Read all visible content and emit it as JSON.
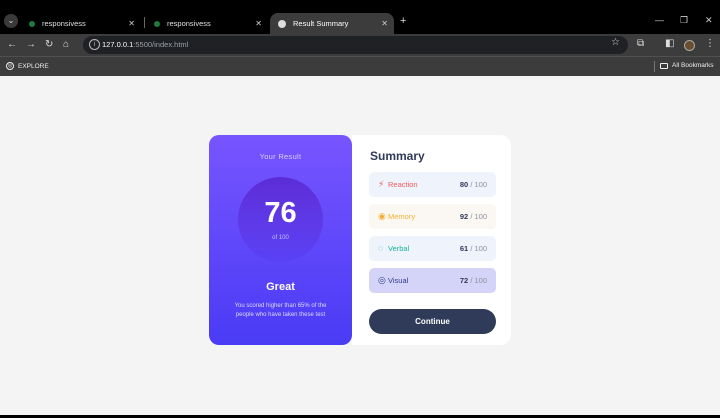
{
  "browser": {
    "tabs": [
      {
        "title": "responsivess"
      },
      {
        "title": "responsivess"
      },
      {
        "title": "Result Summary"
      }
    ],
    "url_host": "127.0.0.1",
    "url_rest": ":5500/index.html",
    "bookmarks": {
      "explore": "EXPLORE",
      "all": "All Bookmarks"
    }
  },
  "result": {
    "heading": "Your Result",
    "score": "76",
    "score_of": "of 100",
    "rating": "Great",
    "blurb": "You scored higher than 65% of the people who have taken these test"
  },
  "summary": {
    "title": "Summary",
    "items": [
      {
        "label": "Reaction",
        "score": "80",
        "total": "/ 100",
        "color": "#f05a5a",
        "icon": "lightning-icon"
      },
      {
        "label": "Memory",
        "score": "92",
        "total": "/ 100",
        "color": "#f2b134",
        "icon": "brain-icon"
      },
      {
        "label": "Verbal",
        "score": "61",
        "total": "/ 100",
        "color": "#18b498",
        "icon": "chat-icon"
      },
      {
        "label": "Visual",
        "score": "72",
        "total": "/ 100",
        "color": "#2c3a8c",
        "icon": "eye-icon"
      }
    ],
    "continue_label": "Continue"
  },
  "colors": {
    "accent": "#7755ff",
    "dark_button": "#303b59"
  }
}
